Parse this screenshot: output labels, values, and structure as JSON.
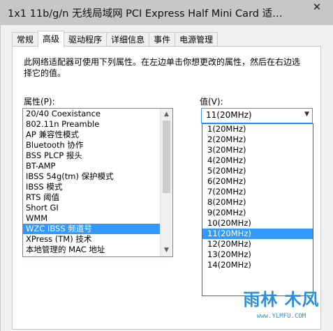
{
  "window": {
    "title": "1x1 11b/g/n 无线局域网 PCI Express Half Mini Card 适…",
    "close_icon": "close-icon"
  },
  "tabs": [
    {
      "label": "常规"
    },
    {
      "label": "高级"
    },
    {
      "label": "驱动程序"
    },
    {
      "label": "详细信息"
    },
    {
      "label": "事件"
    },
    {
      "label": "电源管理"
    }
  ],
  "active_tab": "高级",
  "description": "此网络适配器可使用下列属性。在左边单击你想更改的属性，然后在右边选择它的值。",
  "property_label": "属性(P):",
  "value_label": "值(V):",
  "properties": [
    "20/40 Coexistance",
    "802.11n Preamble",
    "AP 兼容性模式",
    "Bluetooth 协作",
    "BSS PLCP 报头",
    "BT-AMP",
    "IBSS 54g(tm) 保护模式",
    "IBSS 模式",
    "RTS 阈值",
    "Short GI",
    "WMM",
    "WZC IBSS 频道号",
    "XPress (TM) 技术",
    "本地管理的 MAC 地址"
  ],
  "selected_property": "WZC IBSS 频道号",
  "value_selected": "11(20MHz)",
  "value_options": [
    "1(20MHz)",
    "2(20MHz)",
    "3(20MHz)",
    "4(20MHz)",
    "5(20MHz)",
    "6(20MHz)",
    "7(20MHz)",
    "8(20MHz)",
    "9(20MHz)",
    "10(20MHz)",
    "11(20MHz)",
    "12(20MHz)",
    "13(20MHz)",
    "14(20MHz)"
  ],
  "watermark": {
    "top": "雨林 木风",
    "bottom": "www.YLMFU.COM"
  },
  "colors": {
    "selection": "#3399ff",
    "titlebar": "#c7c7c7",
    "dialog_bg": "#f0f0f0"
  }
}
